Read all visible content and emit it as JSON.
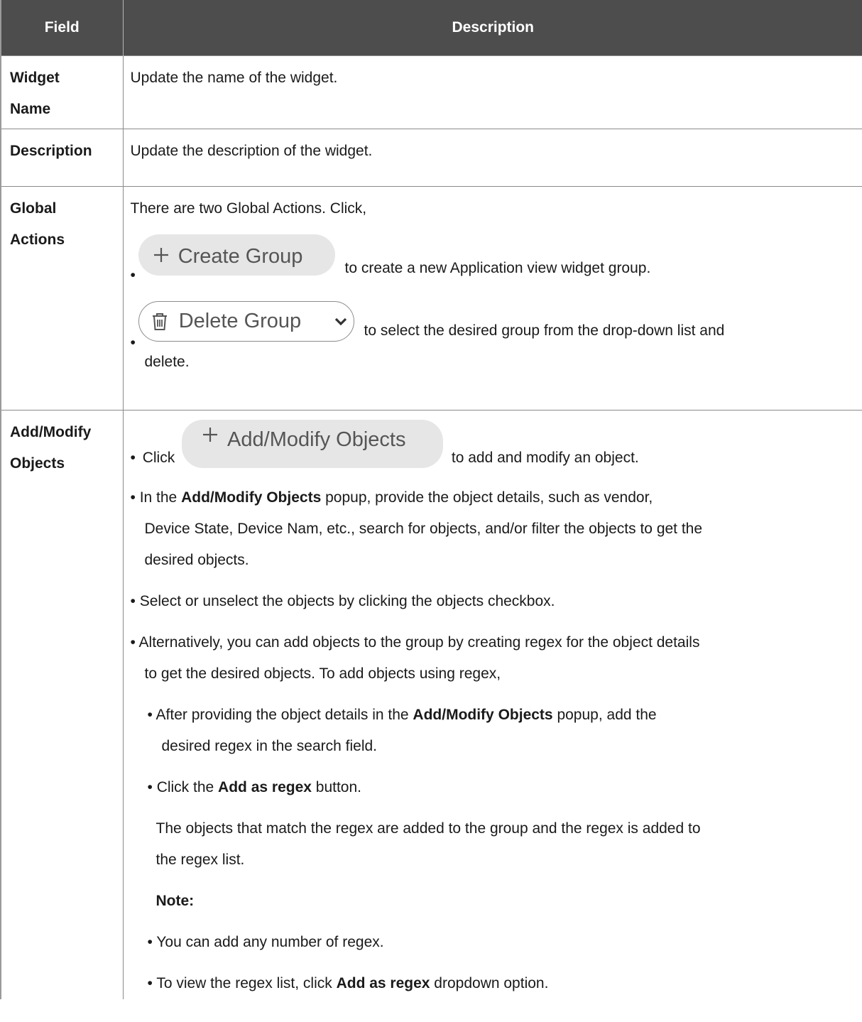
{
  "table": {
    "headers": {
      "field": "Field",
      "description": "Description"
    },
    "rows": {
      "widget_name": {
        "field_line1": "Widget",
        "field_line2": "Name",
        "desc": "Update the name of the widget."
      },
      "description": {
        "field": "Description",
        "desc": "Update the description of the widget."
      },
      "global_actions": {
        "field_line1": "Global",
        "field_line2": "Actions",
        "intro": "There are two Global Actions. Click,",
        "create_button_label": "Create Group",
        "create_text": "to create a new Application view widget group.",
        "delete_button_label": "Delete Group",
        "delete_text": "to select the desired group from the drop-down list and",
        "delete_text_cont": "delete."
      },
      "add_modify": {
        "field_line1": "Add/Modify",
        "field_line2": "Objects",
        "click_prefix": "Click",
        "add_button_label": "Add/Modify Objects",
        "add_text": "to add and modify an object.",
        "p2_pre": "In the ",
        "p2_bold": "Add/Modify Objects",
        "p2_post": " popup, provide the object details, such as vendor,",
        "p2_line2": "Device State, Device Nam, etc., search for objects, and/or filter the objects to get the",
        "p2_line3": "desired objects.",
        "p3": "Select or unselect the objects by clicking the objects checkbox.",
        "p4_line1": "Alternatively, you can add objects to the group by creating regex for the object details",
        "p4_line2": "to get the desired objects. To add objects using regex,",
        "s1_pre": "After providing the object details in the ",
        "s1_bold": "Add/Modify Objects",
        "s1_post": " popup, add the",
        "s1_line2": "desired regex in the search field.",
        "s2_pre": "Click the ",
        "s2_bold": "Add as regex",
        "s2_post": " button.",
        "result_line1": "The objects that match the regex are added to the group and the regex is added to",
        "result_line2": "the regex list.",
        "note_label": "Note:",
        "note1": "You can add any number of regex.",
        "note2_pre": "To view the regex list, click ",
        "note2_bold": "Add as regex",
        "note2_post": " dropdown option."
      }
    }
  }
}
